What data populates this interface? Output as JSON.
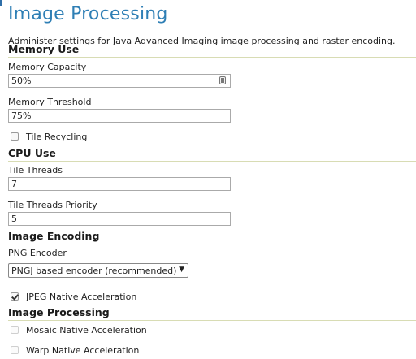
{
  "page": {
    "title": "Image Processing",
    "description": "Administer settings for Java Advanced Imaging image processing and raster encoding."
  },
  "memory_use": {
    "heading": "Memory Use",
    "capacity_label": "Memory Capacity",
    "capacity_value": "50%",
    "threshold_label": "Memory Threshold",
    "threshold_value": "75%",
    "tile_recycling_label": "Tile Recycling",
    "tile_recycling_checked": false
  },
  "cpu_use": {
    "heading": "CPU Use",
    "tile_threads_label": "Tile Threads",
    "tile_threads_value": "7",
    "tile_threads_priority_label": "Tile Threads Priority",
    "tile_threads_priority_value": "5"
  },
  "image_encoding": {
    "heading": "Image Encoding",
    "png_encoder_label": "PNG Encoder",
    "png_encoder_selected": "PNGJ based encoder (recommended)",
    "jpeg_native_label": "JPEG Native Acceleration",
    "jpeg_native_checked": true
  },
  "image_processing": {
    "heading": "Image Processing",
    "mosaic_native_label": "Mosaic Native Acceleration",
    "warp_native_label": "Warp Native Acceleration"
  },
  "icons": {
    "capacity_field_icon": "field-widget-icon",
    "select_arrow": "▼"
  }
}
